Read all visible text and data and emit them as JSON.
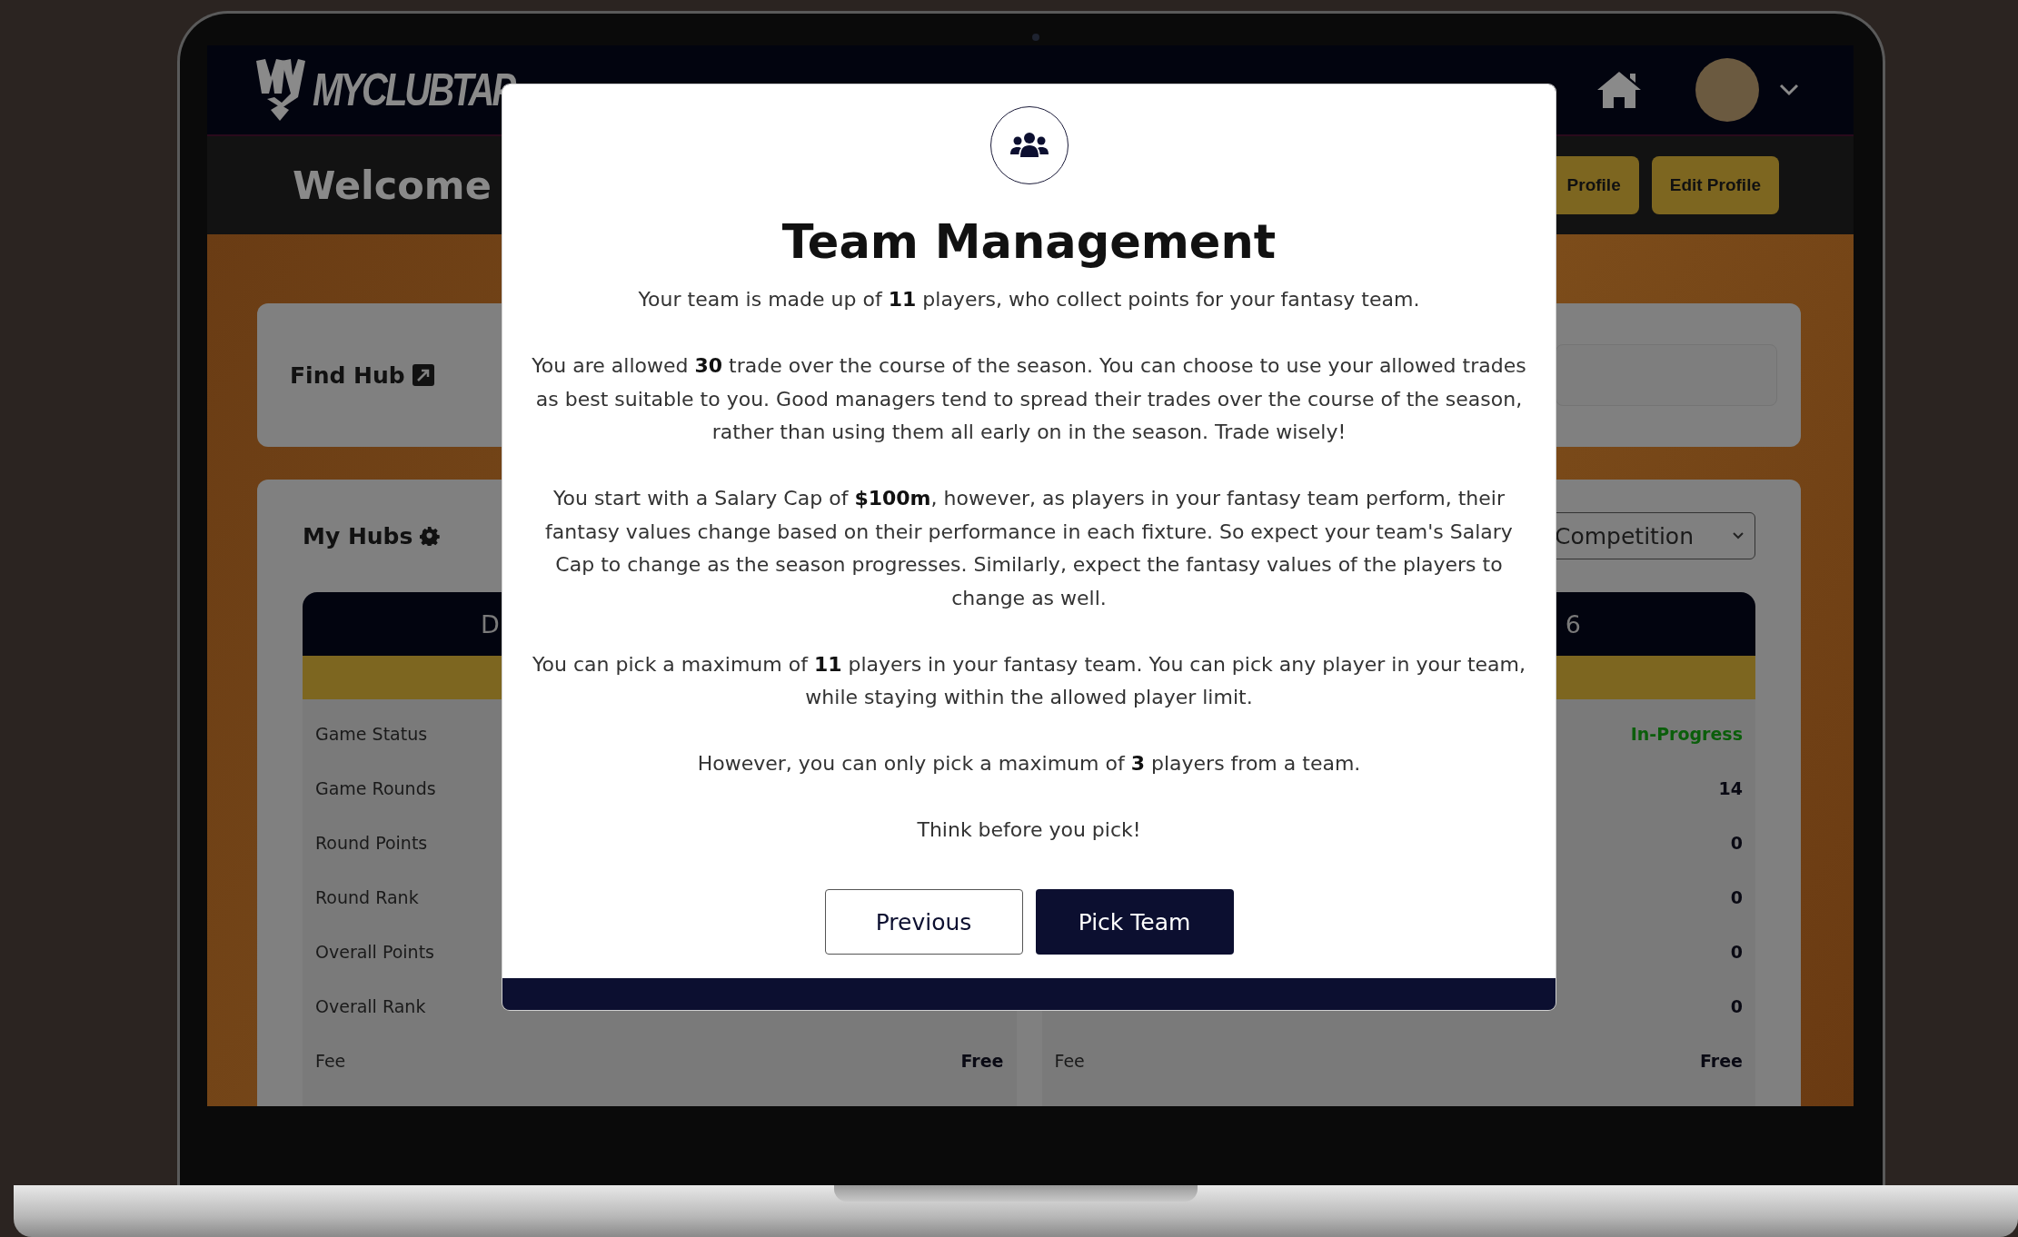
{
  "navbar": {
    "logo_text": "MYCLUBTAP"
  },
  "welcome": {
    "heading": "Welcome",
    "buttons": [
      "Profile",
      "Edit Profile"
    ]
  },
  "find_hub": {
    "title": "Find Hub"
  },
  "my_hubs": {
    "title": "My Hubs",
    "filter": {
      "value": "Competition"
    },
    "hubs": [
      {
        "heading": "D",
        "rows": [
          {
            "label": "Game Status",
            "kind": "plain"
          },
          {
            "label": "Game Rounds",
            "kind": "plain"
          },
          {
            "label": "Round Points",
            "kind": "plain"
          },
          {
            "label": "Round Rank",
            "kind": "plain"
          },
          {
            "label": "Overall Points",
            "kind": "plain"
          },
          {
            "label": "Overall Rank",
            "kind": "plain"
          },
          {
            "label": "Fee",
            "value": "Free",
            "kind": "plain"
          }
        ]
      },
      {
        "heading": "6",
        "rows": [
          {
            "value": "In-Progress",
            "kind": "status"
          },
          {
            "value": "14",
            "kind": "plain"
          },
          {
            "value": "0",
            "kind": "plain"
          },
          {
            "value": "0",
            "kind": "plain"
          },
          {
            "value": "0",
            "kind": "plain"
          },
          {
            "value": "0",
            "kind": "plain"
          },
          {
            "label": "Fee",
            "value": "Free",
            "kind": "plain"
          }
        ]
      }
    ]
  },
  "modal": {
    "title": "Team Management",
    "paragraphs": [
      "Your team is made up of **11** players, who collect points for your fantasy team.",
      "You are allowed **30** trade over the course of the season. You can choose to use your allowed trades as best suitable to you. Good managers tend to spread their trades over the course of the season, rather than using them all early on in the season. Trade wisely!",
      "You start with a Salary Cap of **$100m**, however, as players in your fantasy team perform, their fantasy values change based on their performance in each fixture. So expect your team's Salary Cap to change as the season progresses. Similarly, expect the fantasy values of the players to change as well.",
      "You can pick a maximum of **11** players in your fantasy team. You can pick any player in your team, while staying within the allowed player limit.",
      "However, you can only pick a maximum of **3** players from a team.",
      "Think before you pick!"
    ],
    "buttons": [
      {
        "label": "Previous",
        "kind": "secondary"
      },
      {
        "label": "Pick Team",
        "kind": "primary"
      }
    ]
  }
}
